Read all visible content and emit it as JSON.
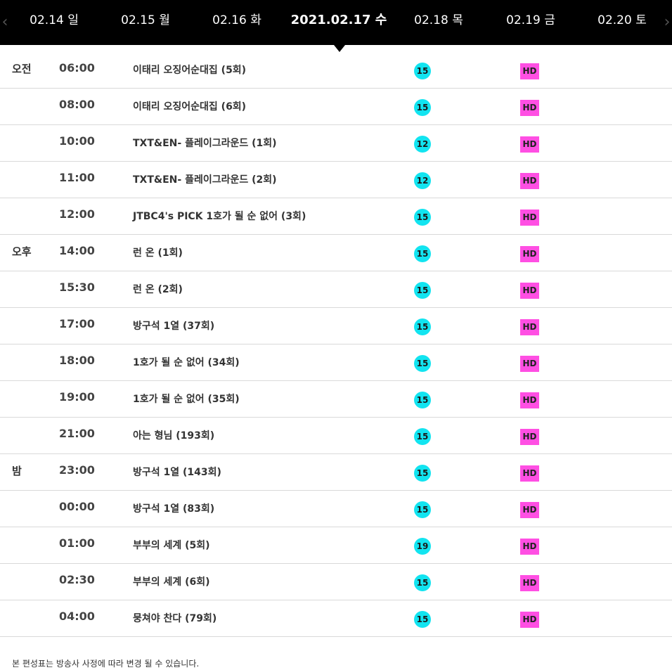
{
  "colors": {
    "header_bg": "#000000",
    "rating_badge": "#12e4f0",
    "hd_badge": "#ff4fe3",
    "divider": "#d9d9d9"
  },
  "nav": {
    "prev_icon": "chevron-left-icon",
    "next_icon": "chevron-right-icon",
    "prev_glyph": "‹",
    "next_glyph": "›"
  },
  "dates": [
    {
      "label": "02.14 일",
      "active": false
    },
    {
      "label": "02.15 월",
      "active": false
    },
    {
      "label": "02.16 화",
      "active": false
    },
    {
      "label": "2021.02.17 수",
      "active": true
    },
    {
      "label": "02.18 목",
      "active": false
    },
    {
      "label": "02.19 금",
      "active": false
    },
    {
      "label": "02.20 토",
      "active": false
    }
  ],
  "schedule": [
    {
      "period": "오전",
      "time": "06:00",
      "title": "이태리 오징어순대집 (5회)",
      "rating": "15",
      "quality": "HD"
    },
    {
      "period": "",
      "time": "08:00",
      "title": "이태리 오징어순대집 (6회)",
      "rating": "15",
      "quality": "HD"
    },
    {
      "period": "",
      "time": "10:00",
      "title": "TXT&EN- 플레이그라운드 (1회)",
      "rating": "12",
      "quality": "HD"
    },
    {
      "period": "",
      "time": "11:00",
      "title": "TXT&EN- 플레이그라운드 (2회)",
      "rating": "12",
      "quality": "HD"
    },
    {
      "period": "",
      "time": "12:00",
      "title": "JTBC4's PICK 1호가 될 순 없어 (3회)",
      "rating": "15",
      "quality": "HD"
    },
    {
      "period": "오후",
      "time": "14:00",
      "title": "런 온 (1회)",
      "rating": "15",
      "quality": "HD"
    },
    {
      "period": "",
      "time": "15:30",
      "title": "런 온 (2회)",
      "rating": "15",
      "quality": "HD"
    },
    {
      "period": "",
      "time": "17:00",
      "title": "방구석 1열 (37회)",
      "rating": "15",
      "quality": "HD"
    },
    {
      "period": "",
      "time": "18:00",
      "title": "1호가 될 순 없어 (34회)",
      "rating": "15",
      "quality": "HD"
    },
    {
      "period": "",
      "time": "19:00",
      "title": "1호가 될 순 없어 (35회)",
      "rating": "15",
      "quality": "HD"
    },
    {
      "period": "",
      "time": "21:00",
      "title": "아는 형님 (193회)",
      "rating": "15",
      "quality": "HD"
    },
    {
      "period": "밤",
      "time": "23:00",
      "title": "방구석 1열 (143회)",
      "rating": "15",
      "quality": "HD"
    },
    {
      "period": "",
      "time": "00:00",
      "title": "방구석 1열 (83회)",
      "rating": "15",
      "quality": "HD"
    },
    {
      "period": "",
      "time": "01:00",
      "title": "부부의 세계 (5회)",
      "rating": "19",
      "quality": "HD"
    },
    {
      "period": "",
      "time": "02:30",
      "title": "부부의 세계 (6회)",
      "rating": "15",
      "quality": "HD"
    },
    {
      "period": "",
      "time": "04:00",
      "title": "뭉쳐야 찬다 (79회)",
      "rating": "15",
      "quality": "HD"
    }
  ],
  "notice": "본 편성표는 방송사 사정에 따라 변경 될 수 있습니다."
}
